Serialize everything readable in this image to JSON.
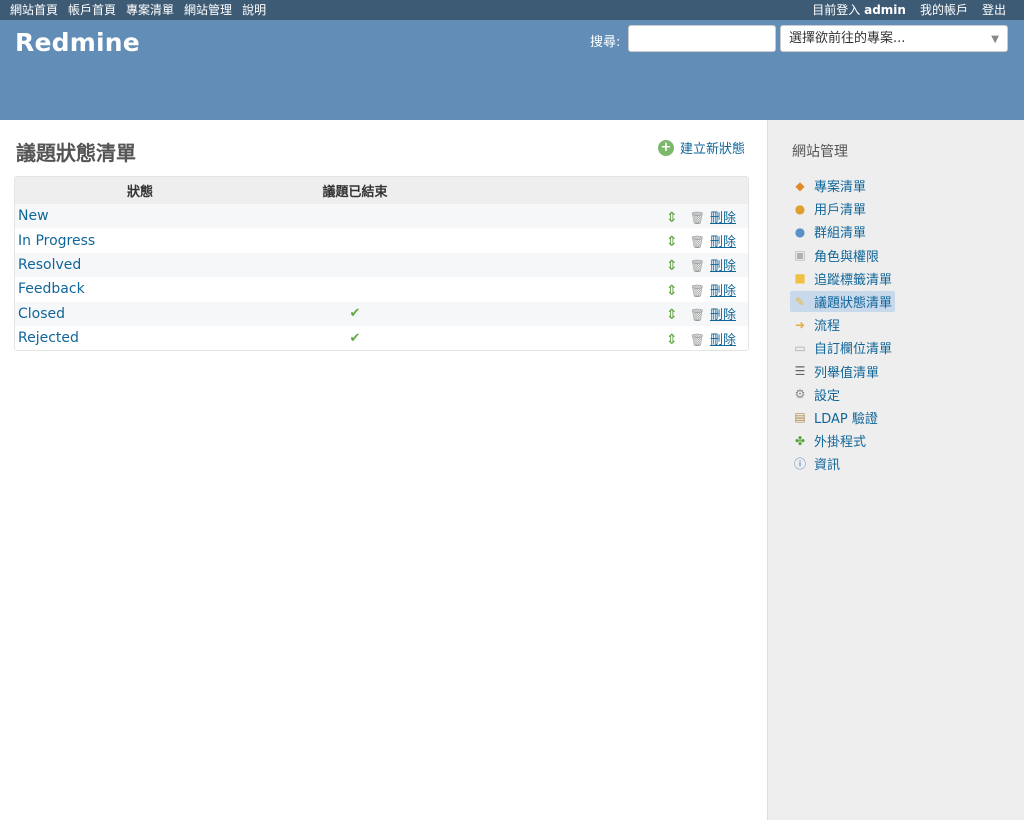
{
  "top_menu": {
    "left": [
      "網站首頁",
      "帳戶首頁",
      "專案清單",
      "網站管理",
      "說明"
    ],
    "logged_in_prefix": "目前登入",
    "user": "admin",
    "my_account": "我的帳戶",
    "logout": "登出"
  },
  "header": {
    "logo": "Redmine",
    "search_label": "搜尋:",
    "search_value": "",
    "project_select": "選擇欲前往的專案..."
  },
  "page": {
    "title": "議題狀態清單",
    "new_status": "建立新狀態"
  },
  "table": {
    "columns": [
      "狀態",
      "議題已結束"
    ],
    "delete_label": "刪除",
    "rows": [
      {
        "name": "New",
        "closed": false
      },
      {
        "name": "In Progress",
        "closed": false
      },
      {
        "name": "Resolved",
        "closed": false
      },
      {
        "name": "Feedback",
        "closed": false
      },
      {
        "name": "Closed",
        "closed": true
      },
      {
        "name": "Rejected",
        "closed": true
      }
    ]
  },
  "sidebar": {
    "title": "網站管理",
    "items": [
      {
        "label": "專案清單",
        "icon": "projects-icon"
      },
      {
        "label": "用戶清單",
        "icon": "user-icon"
      },
      {
        "label": "群組清單",
        "icon": "group-icon"
      },
      {
        "label": "角色與權限",
        "icon": "roles-icon"
      },
      {
        "label": "追蹤標籤清單",
        "icon": "tracker-icon"
      },
      {
        "label": "議題狀態清單",
        "icon": "issue-status-icon",
        "selected": true
      },
      {
        "label": "流程",
        "icon": "workflow-icon"
      },
      {
        "label": "自訂欄位清單",
        "icon": "custom-fields-icon"
      },
      {
        "label": "列舉值清單",
        "icon": "list-icon"
      },
      {
        "label": "設定",
        "icon": "gear-icon"
      },
      {
        "label": "LDAP 驗證",
        "icon": "ldap-icon"
      },
      {
        "label": "外掛程式",
        "icon": "plugin-icon"
      },
      {
        "label": "資訊",
        "icon": "info-icon"
      }
    ]
  },
  "colors": {
    "top_menu_bg": "#3e5b76",
    "header_bg": "#628db6",
    "link": "#116699",
    "sidebar_bg": "#eeeeee",
    "check": "#5fa845"
  }
}
